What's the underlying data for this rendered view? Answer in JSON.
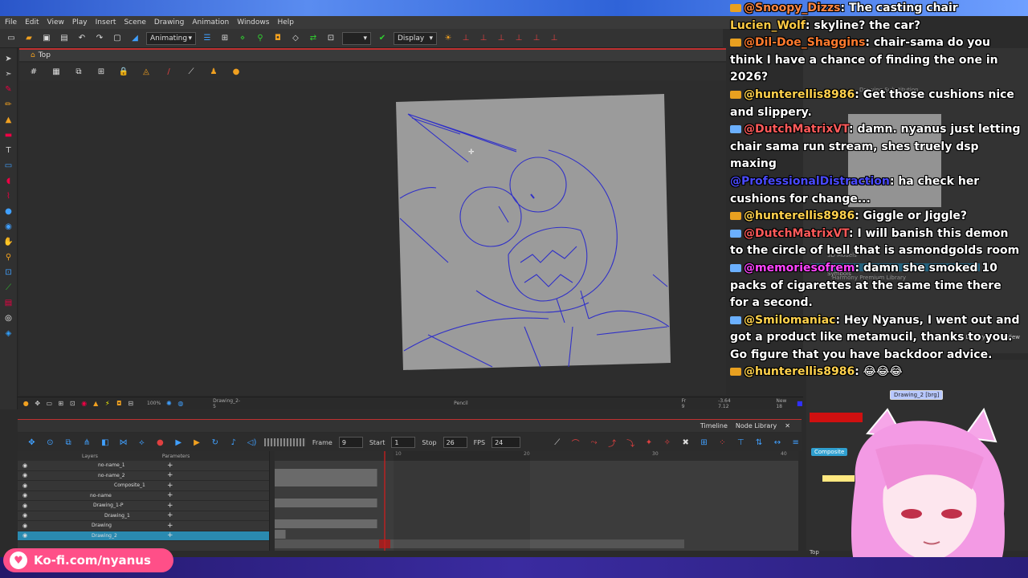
{
  "menubar": {
    "items": [
      "File",
      "Edit",
      "View",
      "Play",
      "Insert",
      "Scene",
      "Drawing",
      "Animation",
      "Windows",
      "Help"
    ]
  },
  "toolbar": {
    "mode_select": "Animating",
    "display_select": "Display"
  },
  "viewport": {
    "tab_label": "Top",
    "status_zoom": "100%",
    "status_layer": "Drawing_2-5",
    "status_tool": "Pencil",
    "status_frame": "Fr 9",
    "status_coords": "-3.64 7.12",
    "status_drawing": "New 18"
  },
  "timeline": {
    "tabs": [
      "Timeline",
      "Node Library"
    ],
    "frame_label": "Frame",
    "frame_value": "9",
    "start_label": "Start",
    "start_value": "1",
    "stop_label": "Stop",
    "stop_value": "26",
    "fps_label": "FPS",
    "fps_value": "24",
    "layers_header": "Layers",
    "params_header": "Parameters",
    "ruler_marks": [
      "10",
      "20",
      "30",
      "40"
    ],
    "layers": [
      {
        "name": "no-name_1",
        "indent": 100
      },
      {
        "name": "no-name_2",
        "indent": 100
      },
      {
        "name": "Composite_1",
        "indent": 120
      },
      {
        "name": "no-name",
        "indent": 90
      },
      {
        "name": "Drawing_1-P",
        "indent": 94
      },
      {
        "name": "Drawing_1",
        "indent": 108
      },
      {
        "name": "Drawing",
        "indent": 92
      },
      {
        "name": "Drawing_2",
        "indent": 92
      }
    ]
  },
  "right_dock": {
    "drawing_substitution": "Drawing Substitution",
    "library_items": [
      "3D Models",
      "Symbols",
      "Harmony Premium Library"
    ],
    "node_view_tabs": [
      "Library",
      "Node View"
    ],
    "nodes": [
      "Drawing_2 [brg]",
      "Composite"
    ],
    "bottom_tab": "Top"
  },
  "chat": [
    {
      "user": "@Snoopy_Dizzs",
      "text": ": The casting chair",
      "color": "#ff8844",
      "badge": "yt"
    },
    {
      "user": "Lucien_Wolf",
      "text": ": skyline? the car?",
      "color": "#ffcc44",
      "badge": "none"
    },
    {
      "user": "@Dil-Doe_Shaggins",
      "text": ": chair-sama do you think I have a chance of finding the one in 2026?",
      "color": "#ff7b2e",
      "badge": "yt"
    },
    {
      "user": "@hunterellis8986",
      "text": ": Get those cushions nice and slippery.",
      "color": "#ffd24d",
      "badge": "yt"
    },
    {
      "user": "@DutchMatrixVT",
      "text": ": damn. nyanus just letting chair sama run stream, shes truely dsp maxing",
      "color": "#ff5a5a",
      "badge": "wr"
    },
    {
      "user": "@ProfessionalDistraction",
      "text": ": ha check her cushions for change...",
      "color": "#4a4aff",
      "badge": "none"
    },
    {
      "user": "@hunterellis8986",
      "text": ": Giggle or Jiggle?",
      "color": "#ffd24d",
      "badge": "yt"
    },
    {
      "user": "@DutchMatrixVT",
      "text": ": I will banish this demon to the circle of hell that is asmondgolds room",
      "color": "#ff5a5a",
      "badge": "wr"
    },
    {
      "user": "@memoriesofrem",
      "text": ": damn she smoked 10 packs of cigarettes at the same time there for a second.",
      "color": "#ff44ff",
      "badge": "wr"
    },
    {
      "user": "@Smilomaniac",
      "text": ": Hey Nyanus, I went out and got a product like metamucil, thanks to you. Go figure that you have backdoor advice.",
      "color": "#ffd24d",
      "badge": "wr"
    },
    {
      "user": "@hunterellis8986",
      "text": ": 😂😂😂",
      "color": "#ffd24d",
      "badge": "yt"
    }
  ],
  "kofi": {
    "label": "Ko-fi.com/nyanus"
  },
  "colors": {
    "accent_red": "#c03030",
    "sketch_line": "#3030c8",
    "canvas_grey": "#9a9a9a",
    "kofi_pink": "#ff4f88"
  }
}
